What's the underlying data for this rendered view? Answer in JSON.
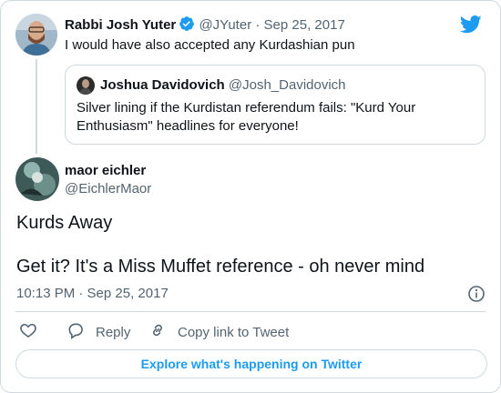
{
  "colors": {
    "accent": "#1d9bf0",
    "muted": "#536471",
    "text": "#0f1419",
    "border": "#cfd9de"
  },
  "parent_tweet": {
    "author_name": "Rabbi Josh Yuter",
    "verified_icon": "verified-badge-icon",
    "handle": "@JYuter",
    "separator": "·",
    "date": "Sep 25, 2017",
    "text": "I would have also accepted any Kurdashian pun",
    "quoted_tweet": {
      "author_name": "Joshua Davidovich",
      "handle": "@Josh_Davidovich",
      "text": "Silver lining if the Kurdistan referendum fails: \"Kurd Your Enthusiasm\" headlines for everyone!"
    }
  },
  "main_tweet": {
    "author_name": "maor eichler",
    "handle": "@EichlerMaor",
    "text_line1": "Kurds Away",
    "text_line2": "Get it? It's a Miss Muffet reference - oh never mind",
    "timestamp": "10:13 PM · Sep 25, 2017"
  },
  "actions": {
    "like_icon": "heart-icon",
    "reply_label": "Reply",
    "copy_label": "Copy link to Tweet"
  },
  "explore_label": "Explore what's happening on Twitter",
  "brand_icon": "twitter-bird-icon"
}
